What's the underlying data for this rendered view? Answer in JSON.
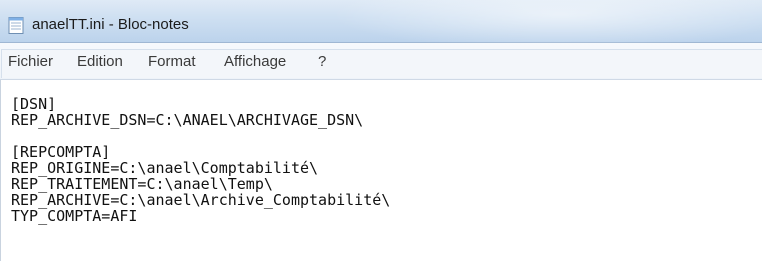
{
  "window": {
    "title": "anaelTT.ini - Bloc-notes"
  },
  "menu": {
    "items": [
      {
        "label": "Fichier"
      },
      {
        "label": "Edition"
      },
      {
        "label": "Format"
      },
      {
        "label": "Affichage"
      },
      {
        "label": "?"
      }
    ]
  },
  "editor": {
    "lines": [
      "[DSN]",
      "REP_ARCHIVE_DSN=C:\\ANAEL\\ARCHIVAGE_DSN\\",
      "",
      "[REPCOMPTA]",
      "REP_ORIGINE=C:\\anael\\Comptabilité\\",
      "REP_TRAITEMENT=C:\\anael\\Temp\\",
      "REP_ARCHIVE=C:\\anael\\Archive_Comptabilité\\",
      "TYP_COMPTA=AFI"
    ]
  },
  "icons": {
    "app": "notepad-icon"
  }
}
